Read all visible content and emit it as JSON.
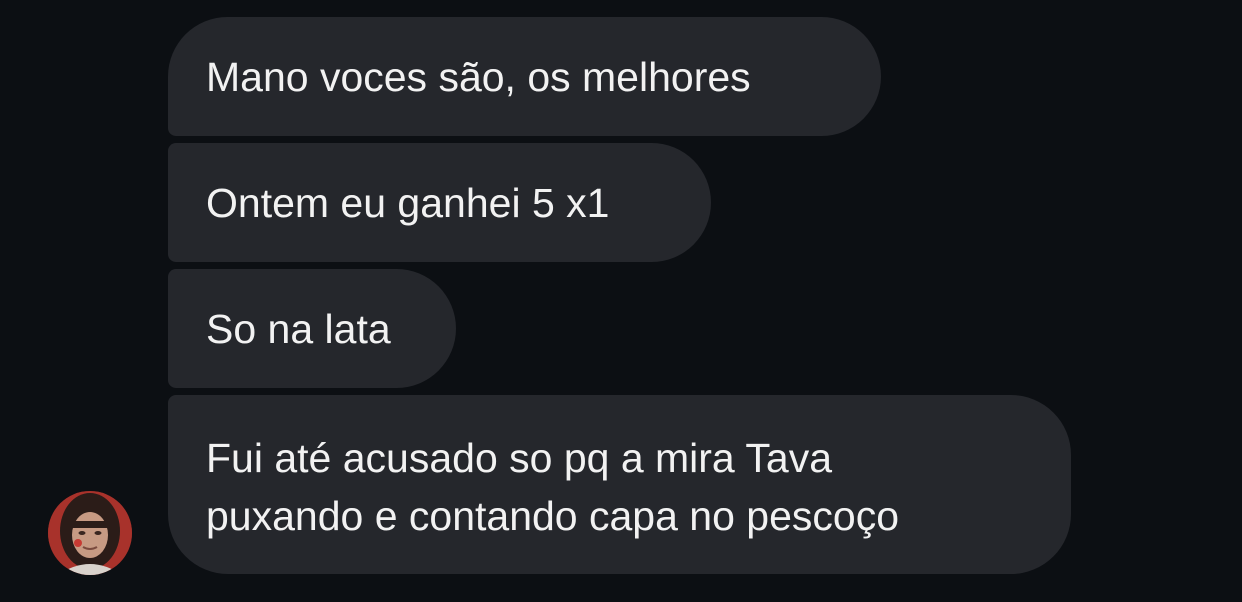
{
  "messages": [
    {
      "text": "Mano voces são, os melhores"
    },
    {
      "text": "Ontem eu ganhei 5 x1"
    },
    {
      "text": "So na lata"
    },
    {
      "text": "Fui até acusado so pq a mira Tava\npuxando e contando capa no pescoço"
    }
  ],
  "avatar": {
    "icon": "user-avatar-photo"
  },
  "colors": {
    "background": "#0c0f13",
    "bubble": "#25272c",
    "text": "#f2f2f2"
  }
}
